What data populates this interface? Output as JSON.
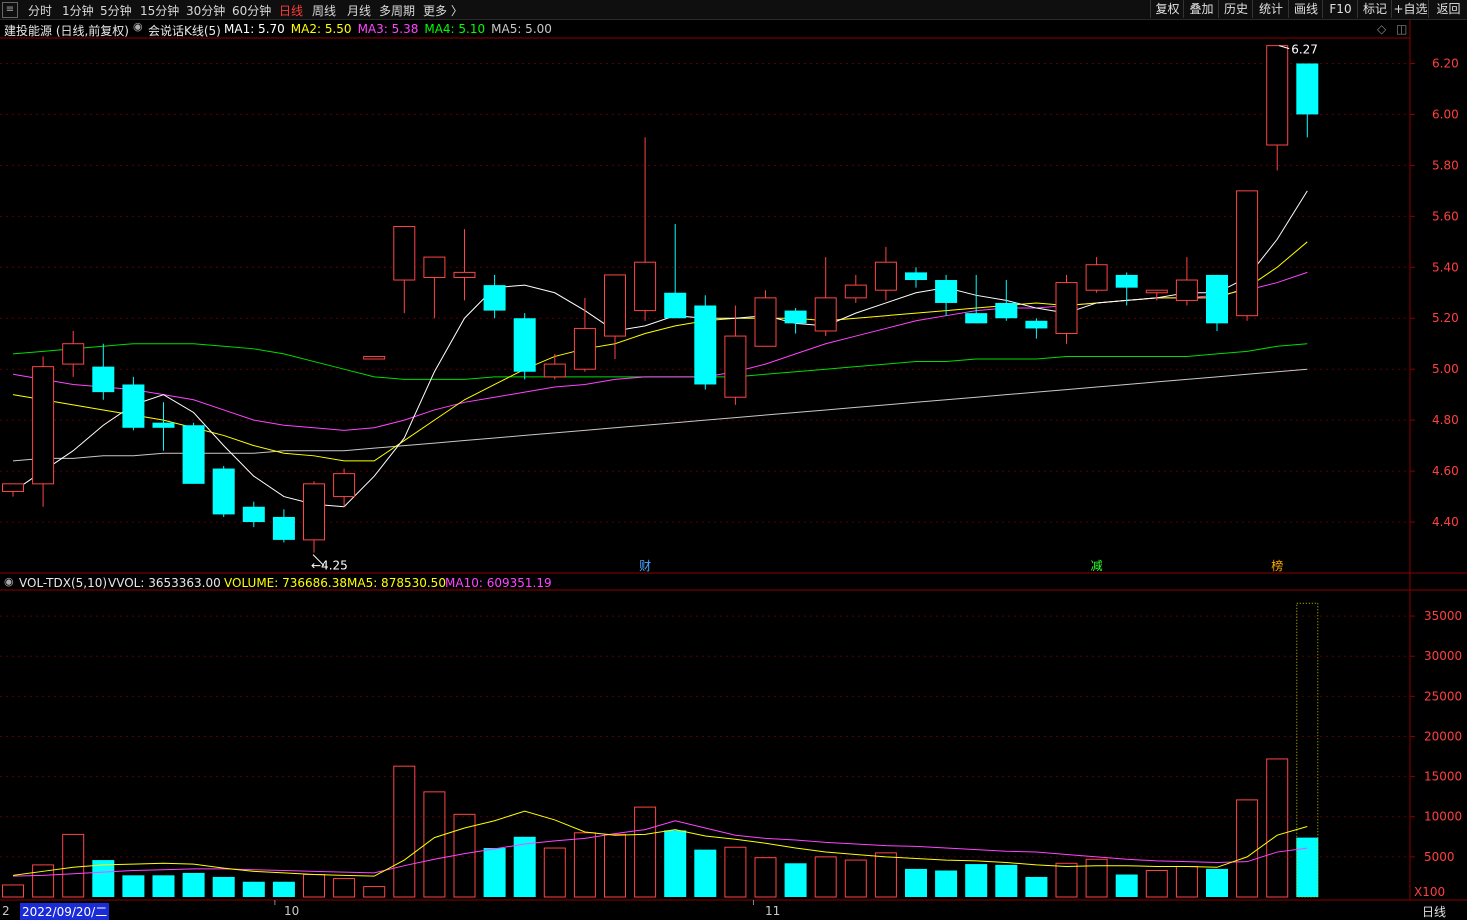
{
  "topbar": {
    "periods": [
      "分时",
      "1分钟",
      "5分钟",
      "15分钟",
      "30分钟",
      "60分钟",
      "日线",
      "周线",
      "月线",
      "多周期",
      "更多 〉"
    ],
    "active_period": "日线",
    "right_buttons": [
      "复权",
      "叠加",
      "历史",
      "统计",
      "画线",
      "F10",
      "标记",
      "+自选",
      "返回"
    ]
  },
  "main_panel": {
    "stock": "建投能源 (日线,前复权)",
    "indicator": "会说话K线(5)",
    "ma_values": [
      {
        "label": "MA1: 5.70",
        "color": "#ffffff"
      },
      {
        "label": "MA2: 5.50",
        "color": "#ffff00"
      },
      {
        "label": "MA3: 5.38",
        "color": "#ff44ff"
      },
      {
        "label": "MA4: 5.10",
        "color": "#00ff00"
      },
      {
        "label": "MA5: 5.00",
        "color": "#c8c8c8"
      }
    ],
    "max_label": "6.27",
    "min_label": "4.25",
    "price_ticks": [
      "6.20",
      "6.00",
      "5.80",
      "5.60",
      "5.40",
      "5.20",
      "5.00",
      "4.80",
      "4.60",
      "4.40"
    ],
    "markers": [
      {
        "text": "财",
        "color": "#4aa8ff",
        "index": 21
      },
      {
        "text": "减",
        "color": "#33ff33",
        "index": 36
      },
      {
        "text": "榜",
        "color": "#ffaa00",
        "index": 42
      }
    ]
  },
  "volume_panel": {
    "name": "VOL-TDX(5,10)",
    "vvol": "VVOL: 3653363.00",
    "volume": "VOLUME: 736686.38",
    "ma5": "MA5: 878530.50",
    "ma10": "MA10: 609351.19",
    "ticks": [
      "35000",
      "30000",
      "25000",
      "20000",
      "15000",
      "10000",
      "5000"
    ],
    "unit": "X100"
  },
  "date_axis": {
    "start": "2022/09/20/二",
    "m10": "10",
    "m11": "11",
    "first": "2"
  },
  "status": {
    "period": "日线"
  },
  "colors": {
    "up": "#ff4444",
    "down": "#00ffff",
    "axis": "#8b0000",
    "grid": "#5a0000"
  },
  "chart_data": {
    "type": "candlestick",
    "price_range": [
      4.2,
      6.3
    ],
    "volume_range": [
      0,
      38000
    ],
    "candles": [
      {
        "o": 4.52,
        "h": 4.55,
        "l": 4.5,
        "c": 4.55,
        "v": 1500
      },
      {
        "o": 4.55,
        "h": 5.05,
        "l": 4.46,
        "c": 5.01,
        "v": 4000
      },
      {
        "o": 5.02,
        "h": 5.15,
        "l": 4.97,
        "c": 5.1,
        "v": 7800
      },
      {
        "o": 5.01,
        "h": 5.1,
        "l": 4.88,
        "c": 4.91,
        "v": 4600
      },
      {
        "o": 4.94,
        "h": 4.97,
        "l": 4.76,
        "c": 4.77,
        "v": 2700
      },
      {
        "o": 4.79,
        "h": 4.87,
        "l": 4.68,
        "c": 4.77,
        "v": 2700
      },
      {
        "o": 4.78,
        "h": 4.79,
        "l": 4.56,
        "c": 4.55,
        "v": 3000
      },
      {
        "o": 4.61,
        "h": 4.62,
        "l": 4.42,
        "c": 4.43,
        "v": 2500
      },
      {
        "o": 4.46,
        "h": 4.48,
        "l": 4.38,
        "c": 4.4,
        "v": 1900
      },
      {
        "o": 4.42,
        "h": 4.45,
        "l": 4.32,
        "c": 4.33,
        "v": 1900
      },
      {
        "o": 4.33,
        "h": 4.56,
        "l": 4.28,
        "c": 4.55,
        "v": 2800
      },
      {
        "o": 4.5,
        "h": 4.61,
        "l": 4.46,
        "c": 4.59,
        "v": 2300
      },
      {
        "o": 5.04,
        "h": 5.05,
        "l": 5.04,
        "c": 5.05,
        "v": 1300
      },
      {
        "o": 5.35,
        "h": 5.56,
        "l": 5.22,
        "c": 5.56,
        "v": 16300
      },
      {
        "o": 5.36,
        "h": 5.44,
        "l": 5.2,
        "c": 5.44,
        "v": 13100
      },
      {
        "o": 5.36,
        "h": 5.55,
        "l": 5.27,
        "c": 5.38,
        "v": 10300
      },
      {
        "o": 5.33,
        "h": 5.37,
        "l": 5.2,
        "c": 5.23,
        "v": 6100
      },
      {
        "o": 5.2,
        "h": 5.22,
        "l": 4.96,
        "c": 4.99,
        "v": 7500
      },
      {
        "o": 4.97,
        "h": 5.06,
        "l": 4.96,
        "c": 5.02,
        "v": 6100
      },
      {
        "o": 5.0,
        "h": 5.28,
        "l": 4.99,
        "c": 5.16,
        "v": 8000
      },
      {
        "o": 5.13,
        "h": 5.37,
        "l": 5.04,
        "c": 5.37,
        "v": 7800
      },
      {
        "o": 5.23,
        "h": 5.91,
        "l": 5.19,
        "c": 5.42,
        "v": 11200
      },
      {
        "o": 5.3,
        "h": 5.57,
        "l": 5.24,
        "c": 5.2,
        "v": 8300
      },
      {
        "o": 5.25,
        "h": 5.29,
        "l": 4.92,
        "c": 4.94,
        "v": 5900
      },
      {
        "o": 4.89,
        "h": 5.25,
        "l": 4.86,
        "c": 5.13,
        "v": 6200
      },
      {
        "o": 5.09,
        "h": 5.31,
        "l": 5.09,
        "c": 5.28,
        "v": 4900
      },
      {
        "o": 5.23,
        "h": 5.24,
        "l": 5.14,
        "c": 5.18,
        "v": 4200
      },
      {
        "o": 5.15,
        "h": 5.44,
        "l": 5.13,
        "c": 5.28,
        "v": 5000
      },
      {
        "o": 5.28,
        "h": 5.37,
        "l": 5.26,
        "c": 5.33,
        "v": 4600
      },
      {
        "o": 5.31,
        "h": 5.48,
        "l": 5.27,
        "c": 5.42,
        "v": 5500
      },
      {
        "o": 5.38,
        "h": 5.4,
        "l": 5.32,
        "c": 5.35,
        "v": 3500
      },
      {
        "o": 5.35,
        "h": 5.37,
        "l": 5.21,
        "c": 5.26,
        "v": 3300
      },
      {
        "o": 5.22,
        "h": 5.37,
        "l": 5.18,
        "c": 5.18,
        "v": 4100
      },
      {
        "o": 5.26,
        "h": 5.35,
        "l": 5.19,
        "c": 5.2,
        "v": 4000
      },
      {
        "o": 5.19,
        "h": 5.2,
        "l": 5.12,
        "c": 5.16,
        "v": 2500
      },
      {
        "o": 5.14,
        "h": 5.37,
        "l": 5.1,
        "c": 5.34,
        "v": 4200
      },
      {
        "o": 5.31,
        "h": 5.44,
        "l": 5.3,
        "c": 5.41,
        "v": 4700
      },
      {
        "o": 5.37,
        "h": 5.38,
        "l": 5.25,
        "c": 5.32,
        "v": 2800
      },
      {
        "o": 5.3,
        "h": 5.31,
        "l": 5.27,
        "c": 5.31,
        "v": 3300
      },
      {
        "o": 5.27,
        "h": 5.44,
        "l": 5.25,
        "c": 5.35,
        "v": 3800
      },
      {
        "o": 5.37,
        "h": 5.37,
        "l": 5.15,
        "c": 5.18,
        "v": 3500
      },
      {
        "o": 5.21,
        "h": 5.7,
        "l": 5.19,
        "c": 5.7,
        "v": 12100
      },
      {
        "o": 5.88,
        "h": 6.27,
        "l": 5.78,
        "c": 6.27,
        "v": 17200
      },
      {
        "o": 6.2,
        "h": 6.2,
        "l": 5.91,
        "c": 6.0,
        "v": 7400
      }
    ],
    "ma1": [
      4.52,
      4.6,
      4.68,
      4.78,
      4.86,
      4.9,
      4.83,
      4.7,
      4.58,
      4.5,
      4.47,
      4.46,
      4.58,
      4.73,
      4.99,
      5.2,
      5.32,
      5.33,
      5.3,
      5.23,
      5.15,
      5.17,
      5.21,
      5.2,
      5.2,
      5.21,
      5.18,
      5.17,
      5.22,
      5.26,
      5.3,
      5.32,
      5.29,
      5.27,
      5.24,
      5.22,
      5.26,
      5.27,
      5.28,
      5.3,
      5.3,
      5.36,
      5.51,
      5.7
    ],
    "ma2": [
      4.9,
      4.88,
      4.86,
      4.84,
      4.82,
      4.8,
      4.77,
      4.74,
      4.7,
      4.67,
      4.66,
      4.64,
      4.64,
      4.72,
      4.8,
      4.88,
      4.94,
      5.0,
      5.05,
      5.08,
      5.1,
      5.14,
      5.17,
      5.19,
      5.2,
      5.2,
      5.2,
      5.19,
      5.2,
      5.21,
      5.22,
      5.23,
      5.24,
      5.25,
      5.26,
      5.25,
      5.26,
      5.27,
      5.28,
      5.28,
      5.28,
      5.32,
      5.4,
      5.5
    ],
    "ma3": [
      4.98,
      4.96,
      4.94,
      4.93,
      4.92,
      4.9,
      4.88,
      4.84,
      4.8,
      4.78,
      4.77,
      4.76,
      4.77,
      4.8,
      4.84,
      4.87,
      4.89,
      4.91,
      4.93,
      4.94,
      4.96,
      4.97,
      4.97,
      4.97,
      4.99,
      5.02,
      5.06,
      5.1,
      5.13,
      5.16,
      5.19,
      5.21,
      5.23,
      5.24,
      5.24,
      5.25,
      5.26,
      5.27,
      5.28,
      5.28,
      5.29,
      5.31,
      5.34,
      5.38
    ],
    "ma4": [
      5.06,
      5.07,
      5.08,
      5.09,
      5.1,
      5.1,
      5.1,
      5.09,
      5.08,
      5.06,
      5.03,
      5.0,
      4.97,
      4.96,
      4.96,
      4.96,
      4.97,
      4.97,
      4.97,
      4.97,
      4.97,
      4.97,
      4.97,
      4.97,
      4.97,
      4.98,
      4.99,
      5.0,
      5.01,
      5.02,
      5.03,
      5.03,
      5.04,
      5.04,
      5.04,
      5.05,
      5.05,
      5.05,
      5.05,
      5.05,
      5.06,
      5.07,
      5.09,
      5.1
    ],
    "ma5": [
      4.64,
      4.65,
      4.65,
      4.66,
      4.66,
      4.67,
      4.67,
      4.67,
      4.67,
      4.68,
      4.68,
      4.68,
      4.69,
      4.7,
      4.71,
      4.72,
      4.73,
      4.74,
      4.75,
      4.76,
      4.77,
      4.78,
      4.79,
      4.8,
      4.81,
      4.82,
      4.83,
      4.84,
      4.85,
      4.86,
      4.87,
      4.88,
      4.89,
      4.9,
      4.91,
      4.92,
      4.93,
      4.94,
      4.95,
      4.96,
      4.97,
      4.98,
      4.99,
      5.0
    ],
    "vol_ma5": [
      2700,
      3200,
      3700,
      4000,
      4100,
      4200,
      4100,
      3600,
      3200,
      3000,
      2800,
      2700,
      2600,
      4600,
      7400,
      8600,
      9500,
      10700,
      9600,
      8100,
      7700,
      7800,
      8400,
      7600,
      7200,
      6700,
      6100,
      5600,
      5300,
      5000,
      4800,
      4600,
      4500,
      4300,
      4000,
      3800,
      3900,
      3900,
      3800,
      3800,
      3700,
      5000,
      7700,
      8785
    ],
    "vol_ma10": [
      2600,
      2700,
      2900,
      3100,
      3300,
      3400,
      3500,
      3500,
      3400,
      3300,
      3200,
      3100,
      3000,
      3900,
      4700,
      5400,
      6000,
      6600,
      7000,
      7300,
      7900,
      8400,
      9500,
      8600,
      7700,
      7300,
      7100,
      6800,
      6600,
      6400,
      6300,
      6100,
      5900,
      5700,
      5600,
      5300,
      5000,
      4700,
      4500,
      4400,
      4300,
      4400,
      5600,
      6094
    ]
  }
}
